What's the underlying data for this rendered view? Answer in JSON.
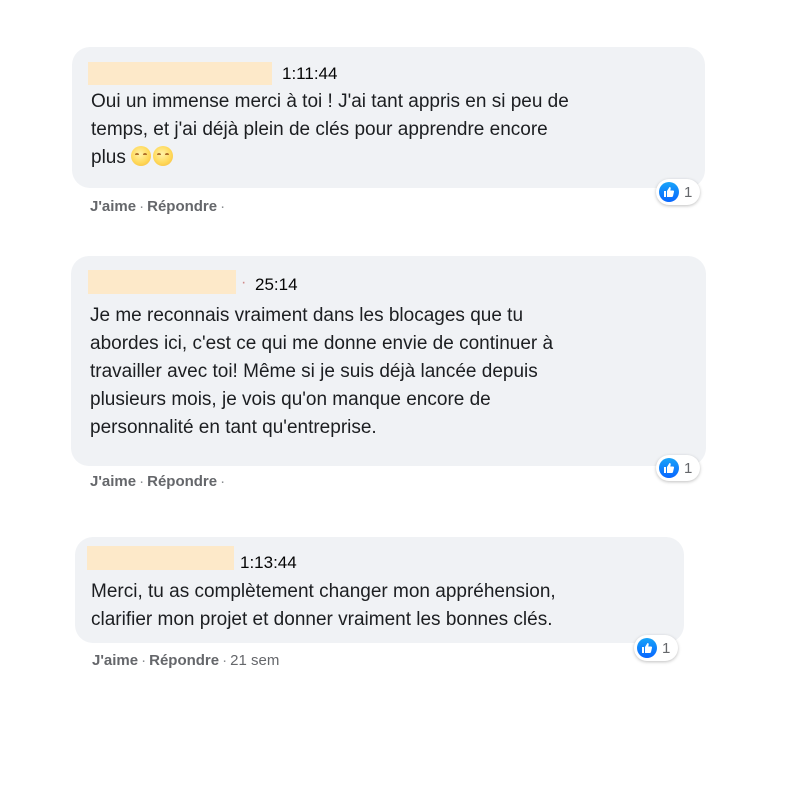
{
  "comments": [
    {
      "timestamp": "1:11:44",
      "lines": [
        "Oui un immense merci à toi ! J'ai tant appris en si peu de",
        "temps, et j'ai déjà plein de clés pour apprendre encore",
        "plus"
      ],
      "emojis": [
        "smiling-face-icon",
        "smiling-face-icon"
      ],
      "reaction_count": "1",
      "like_label": "J'aime",
      "reply_label": "Répondre",
      "age": ""
    },
    {
      "timestamp": "25:14",
      "lines": [
        "Je me reconnais vraiment dans les blocages que tu",
        "abordes ici, c'est ce qui me donne envie de continuer à",
        "travailler avec toi! Même si je suis déjà lancée depuis",
        "plusieurs mois, je vois qu'on manque encore de",
        "personnalité en tant qu'entreprise."
      ],
      "reaction_count": "1",
      "like_label": "J'aime",
      "reply_label": "Répondre",
      "age": ""
    },
    {
      "timestamp": "1:13:44",
      "lines": [
        "Merci, tu as complètement changer mon appréhension,",
        "clarifier mon projet et donner vraiment les bonnes clés."
      ],
      "reaction_count": "1",
      "like_label": "J'aime",
      "reply_label": "Répondre",
      "age": "21 sem"
    }
  ],
  "colors": {
    "bubble": "#f0f2f5",
    "name_redaction": "#fde9c9",
    "like_blue": "#0866ff",
    "meta_gray": "#65676b"
  }
}
